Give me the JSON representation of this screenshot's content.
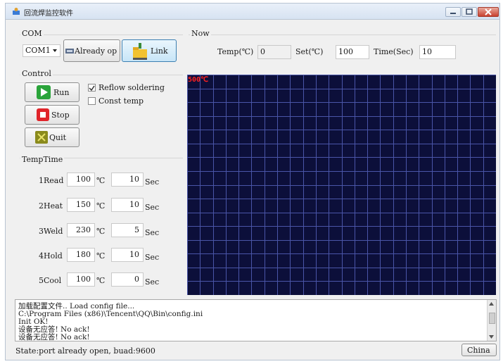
{
  "window": {
    "title": "回流焊监控软件"
  },
  "com": {
    "group_label": "COM",
    "port_value": "COM1",
    "status_button_label": "Already op",
    "link_button_label": "Link"
  },
  "now": {
    "group_label": "Now",
    "temp_label": "Temp(℃)",
    "temp_value": "0",
    "set_label": "Set(℃)",
    "set_value": "100",
    "time_label": "Time(Sec)",
    "time_value": "10"
  },
  "control": {
    "group_label": "Control",
    "run_label": "Run",
    "stop_label": "Stop",
    "quit_label": "Quit",
    "reflow_label": "Reflow soldering",
    "reflow_checked": true,
    "const_label": "Const temp",
    "const_checked": false
  },
  "temptime": {
    "group_label": "TempTime",
    "temp_unit": "℃",
    "time_unit": "Sec",
    "rows": [
      {
        "name": "1Read",
        "temp": "100",
        "time": "10"
      },
      {
        "name": "2Heat",
        "temp": "150",
        "time": "10"
      },
      {
        "name": "3Weld",
        "temp": "230",
        "time": "5"
      },
      {
        "name": "4Hold",
        "temp": "180",
        "time": "10"
      },
      {
        "name": "5Cool",
        "temp": "100",
        "time": "0"
      }
    ]
  },
  "chart_data": {
    "type": "line",
    "title": "",
    "ylabel": "",
    "xlabel": "",
    "max_label": "500℃",
    "ylim": [
      0,
      500
    ],
    "grid": true,
    "series": []
  },
  "log": {
    "lines": [
      "加载配置文件.. Load config file...",
      "C:\\Program Files (x86)\\Tencent\\QQ\\Bin\\config.ini",
      "Init OK!",
      "设备无应答!  No ack!",
      "设备无应答!  No ack!"
    ]
  },
  "status": {
    "text": "State:port already open, buad:9600",
    "language_button": "China"
  },
  "colors": {
    "chart_bg": "#0c0f3a",
    "grid": "#4a55a8",
    "max_label": "#ff2020"
  }
}
